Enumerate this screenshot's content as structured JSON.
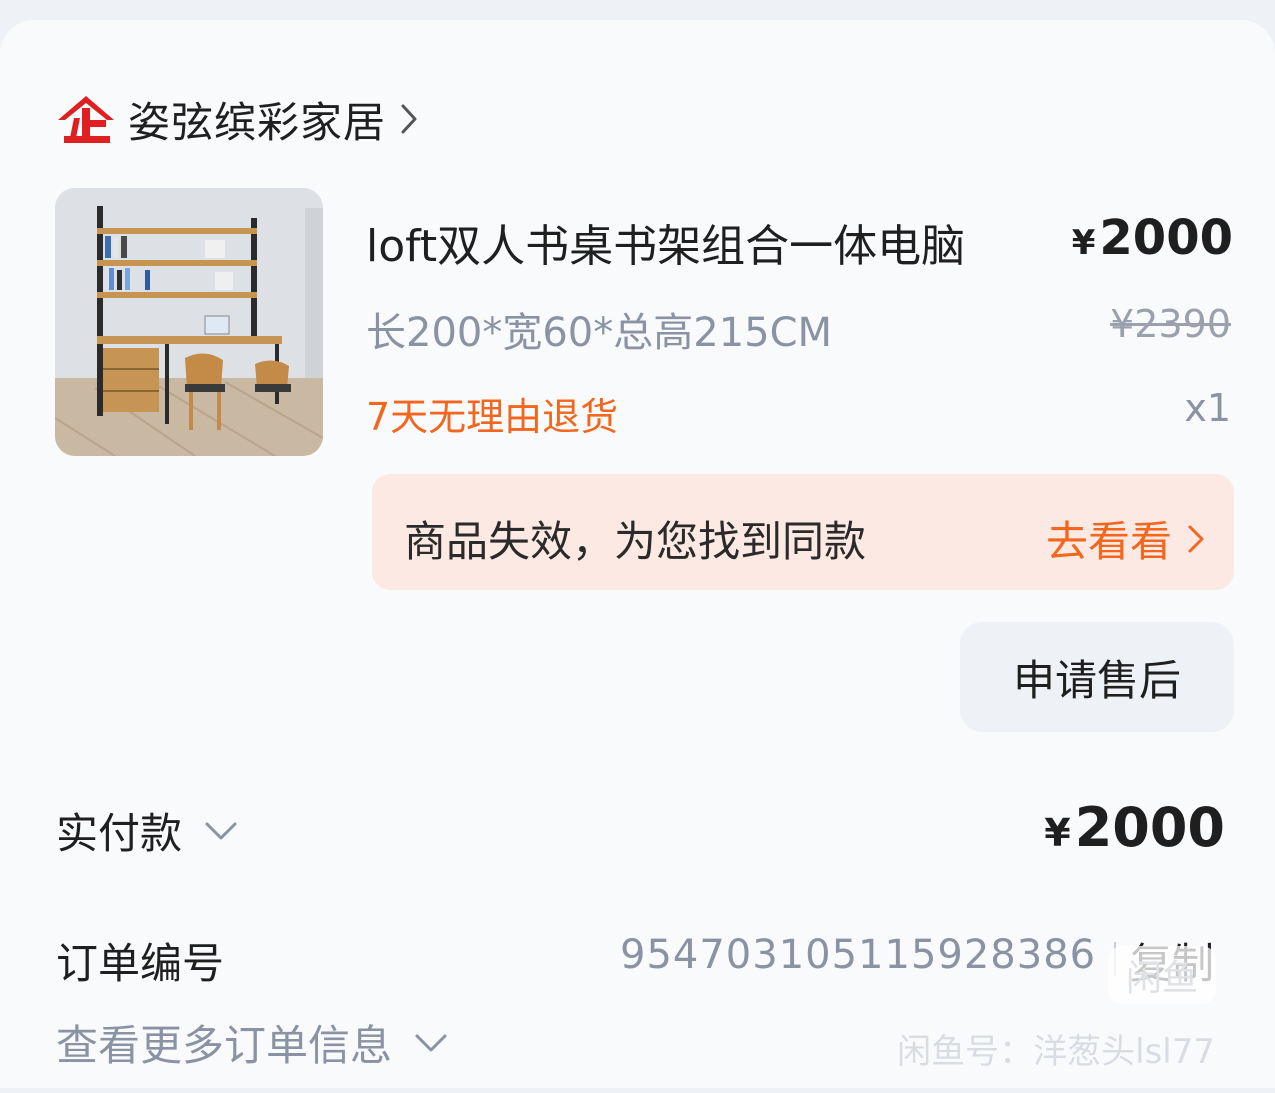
{
  "shop": {
    "icon": "enterprise-shop-icon",
    "name": "姿弦缤彩家居"
  },
  "product": {
    "image_alt": "loft双人书桌书架组合一体电脑",
    "title": "loft双人书桌书架组合一体电脑",
    "currency": "¥",
    "price": "2000",
    "spec": "长200*宽60*总高215CM",
    "original_price": "¥2390",
    "return_policy": "7天无理由退货",
    "quantity": "x1"
  },
  "invalid_notice": {
    "text": "商品失效，为您找到同款",
    "action": "去看看"
  },
  "after_sale_button": "申请售后",
  "payment": {
    "label": "实付款",
    "currency": "¥",
    "amount": "2000"
  },
  "order": {
    "label": "订单编号",
    "number": "954703105115928386",
    "copy": "复制",
    "more": "查看更多订单信息"
  },
  "watermark": {
    "badge": "闲鱼",
    "text": "闲鱼号：洋葱头lsl77"
  },
  "colors": {
    "accent_orange": "#f2661e",
    "shop_icon_red": "#e02020",
    "notice_bg": "#fde9e3",
    "muted_text": "#8a93a3"
  }
}
